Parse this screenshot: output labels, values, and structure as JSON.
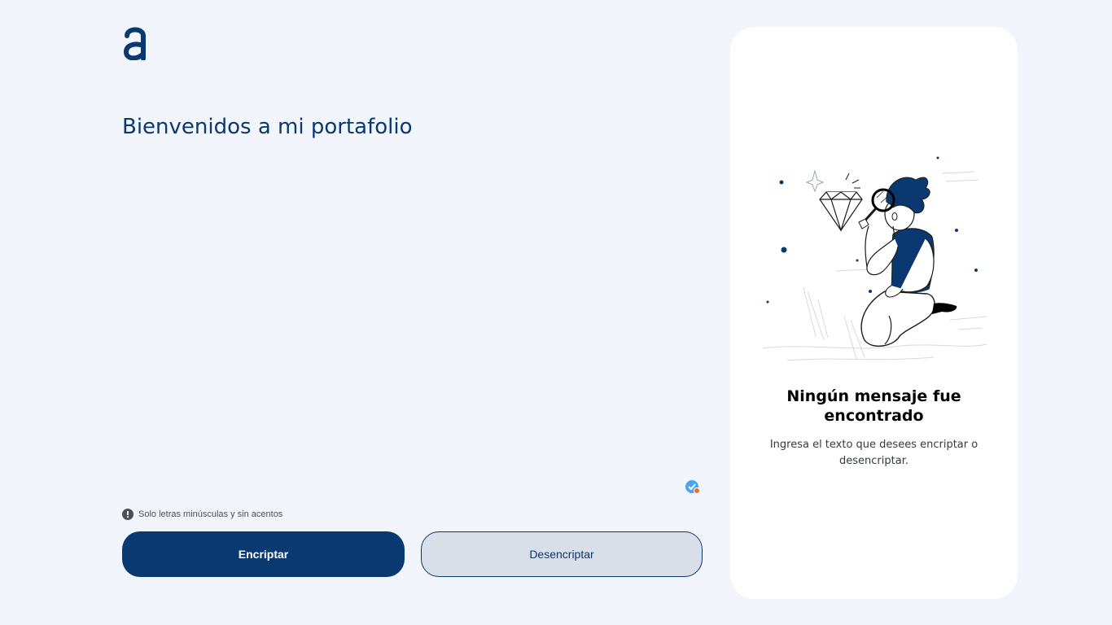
{
  "logo": {
    "icon": "alura-a-logo-icon"
  },
  "input": {
    "value": "Bienvenidos a mi portafolio",
    "color": "#0a3871"
  },
  "hint": {
    "icon": "exclamation-circle-icon",
    "text": "Solo letras minúsculas y sin acentos"
  },
  "buttons": {
    "encrypt_label": "Encriptar",
    "decrypt_label": "Desencriptar"
  },
  "output": {
    "illustration": "person-with-magnifying-glass-and-diamond",
    "title": "Ningún mensaje fue encontrado",
    "description": "Ingresa el texto que desees encriptar o desencriptar."
  },
  "colors": {
    "primary": "#0a3871",
    "background": "#f3f5fc",
    "secondary_button": "#d8dfe8",
    "card": "#ffffff"
  }
}
